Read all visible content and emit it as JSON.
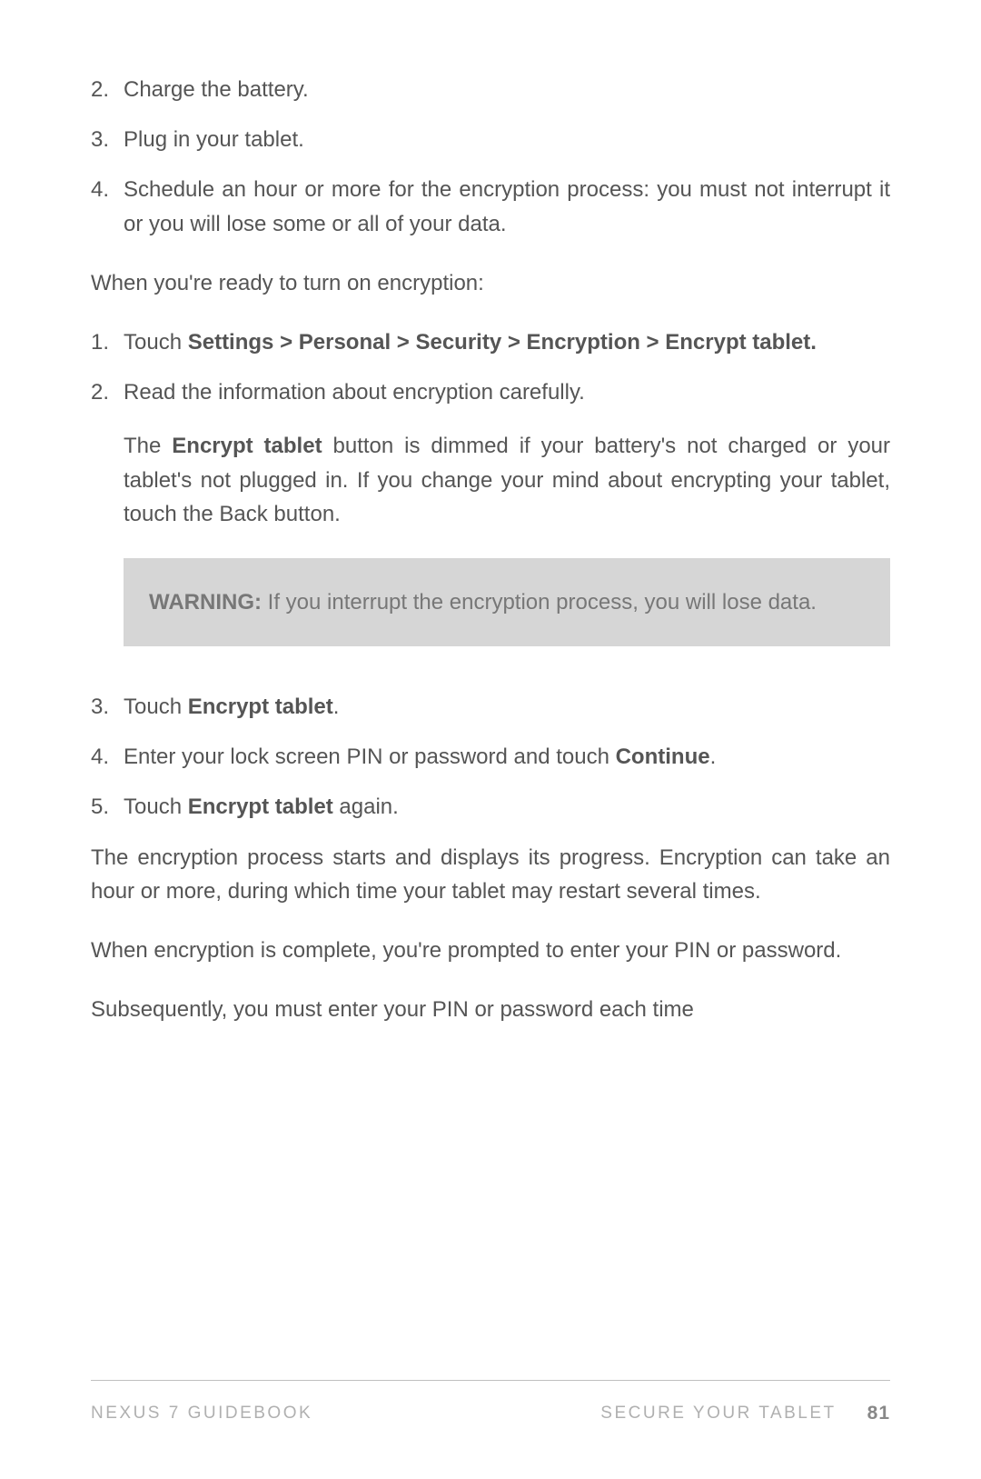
{
  "list1": {
    "i2_num": "2.",
    "i2_txt": "Charge the battery.",
    "i3_num": "3.",
    "i3_txt": "Plug in your tablet.",
    "i4_num": "4.",
    "i4_txt": "Schedule an hour or more for the encryption process: you must not interrupt it or you will lose some or all of your data."
  },
  "intro2": "When you're ready to turn on encryption:",
  "list2": {
    "i1_num": "1.",
    "i1_pre": "Touch ",
    "i1_bold": "Settings > Personal > Security > Encryption > Encrypt tablet.",
    "i2_num": "2.",
    "i2_txt": "Read the information about encryption carefully.",
    "i2_sub_pre": "The ",
    "i2_sub_bold": "Encrypt tablet",
    "i2_sub_post": " button is dimmed if your battery's not charged or your tablet's not plugged in. If you change your mind about encrypting your tablet, touch the Back button.",
    "warn_bold": "WARNING:",
    "warn_txt": " If you interrupt the encryption process, you will lose data.",
    "i3_num": "3.",
    "i3_pre": "Touch ",
    "i3_bold": "Encrypt tablet",
    "i3_post": ".",
    "i4_num": "4.",
    "i4_pre": "Enter your lock screen PIN or password and touch ",
    "i4_bold": "Continue",
    "i4_post": ".",
    "i5_num": "5.",
    "i5_pre": "Touch ",
    "i5_bold": "Encrypt tablet",
    "i5_post": " again."
  },
  "outro1": "The encryption process starts and displays its progress. Encryption can take an hour or more, during which time your tablet may restart several times.",
  "outro2": "When encryption is complete, you're prompted to enter your PIN or password.",
  "outro3": "Subsequently, you must enter your PIN or password each time",
  "footer": {
    "left": "NEXUS 7 GUIDEBOOK",
    "right": "SECURE YOUR TABLET",
    "page": "81"
  }
}
